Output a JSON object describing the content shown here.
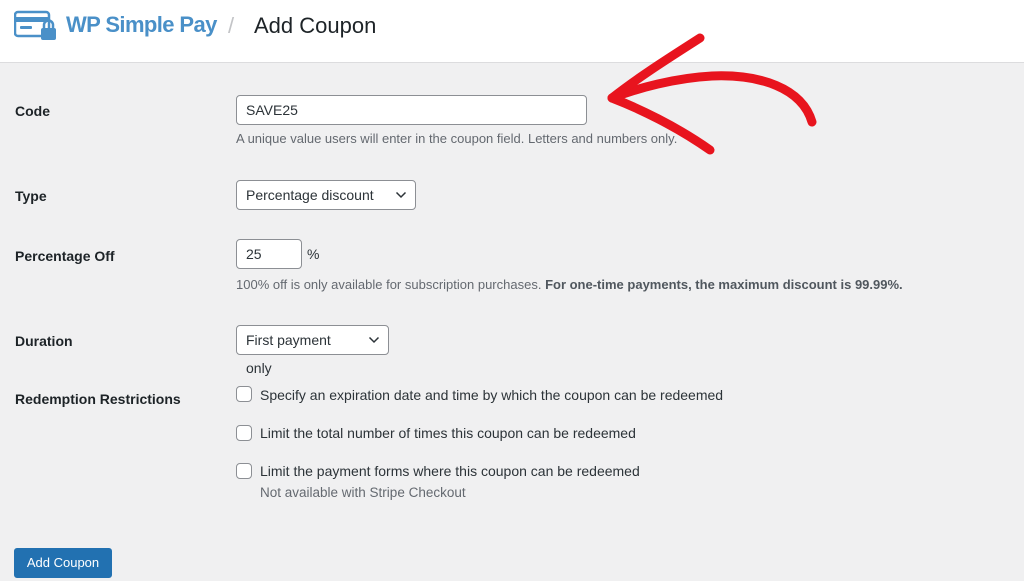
{
  "header": {
    "brand": "WP Simple Pay",
    "separator": "/",
    "page_title": "Add Coupon",
    "brand_color": "#4a90c8"
  },
  "form": {
    "code": {
      "label": "Code",
      "value": "SAVE25",
      "help": "A unique value users will enter in the coupon field. Letters and numbers only."
    },
    "type": {
      "label": "Type",
      "selected": "Percentage discount"
    },
    "percentage_off": {
      "label": "Percentage Off",
      "value": "25",
      "unit": "%",
      "help_plain": "100% off is only available for subscription purchases.",
      "help_bold": "For one-time payments, the maximum discount is 99.99%."
    },
    "duration": {
      "label": "Duration",
      "selected": "First payment only"
    },
    "redemption": {
      "label": "Redemption Restrictions",
      "options": [
        {
          "label": "Specify an expiration date and time by which the coupon can be redeemed",
          "checked": false
        },
        {
          "label": "Limit the total number of times this coupon can be redeemed",
          "checked": false
        },
        {
          "label": "Limit the payment forms where this coupon can be redeemed",
          "checked": false,
          "note": "Not available with Stripe Checkout"
        }
      ]
    }
  },
  "submit_label": "Add Coupon",
  "colors": {
    "primary": "#2271b1",
    "annotation_arrow": "#e8141e",
    "background": "#f0f0f1"
  },
  "icons": {
    "logo": "card-lock-icon",
    "select_arrow": "chevron-down-icon",
    "annotation": "arrow-annotation"
  }
}
